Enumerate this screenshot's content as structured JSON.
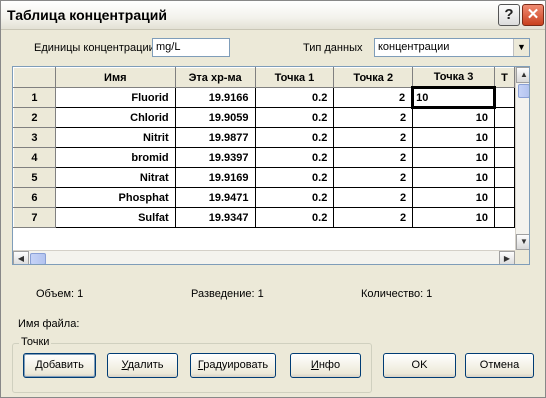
{
  "window": {
    "title": "Таблица концентраций",
    "help_glyph": "?",
    "close_glyph": "✕"
  },
  "units": {
    "label": "Единицы концентрации",
    "value": "mg/L"
  },
  "data_type": {
    "label": "Тип данных",
    "selected": "концентрации"
  },
  "table": {
    "headers": [
      "",
      "Имя",
      "Эта хр-ма",
      "Точка 1",
      "Точка 2",
      "Точка 3",
      "T"
    ],
    "rows": [
      {
        "num": "1",
        "name": "Fluorid",
        "value": "19.9166",
        "p1": "0.2",
        "p2": "2",
        "p3": "10"
      },
      {
        "num": "2",
        "name": "Chlorid",
        "value": "19.9059",
        "p1": "0.2",
        "p2": "2",
        "p3": "10"
      },
      {
        "num": "3",
        "name": "Nitrit",
        "value": "19.9877",
        "p1": "0.2",
        "p2": "2",
        "p3": "10"
      },
      {
        "num": "4",
        "name": "bromid",
        "value": "19.9397",
        "p1": "0.2",
        "p2": "2",
        "p3": "10"
      },
      {
        "num": "5",
        "name": "Nitrat",
        "value": "19.9169",
        "p1": "0.2",
        "p2": "2",
        "p3": "10"
      },
      {
        "num": "6",
        "name": "Phosphat",
        "value": "19.9471",
        "p1": "0.2",
        "p2": "2",
        "p3": "10"
      },
      {
        "num": "7",
        "name": "Sulfat",
        "value": "19.9347",
        "p1": "0.2",
        "p2": "2",
        "p3": "10"
      }
    ]
  },
  "info": {
    "volume": "Объем:  1",
    "dilution": "Разведение:  1",
    "quantity": "Количество:  1",
    "filename_label": "Имя файла:"
  },
  "points_group": {
    "legend": "Точки",
    "add": {
      "hotkey": "Д",
      "rest": "обавить"
    },
    "delete": {
      "hotkey": "У",
      "rest": "далить"
    },
    "calibrate": {
      "hotkey": "Г",
      "rest": "радуировать"
    },
    "info": {
      "hotkey": "И",
      "rest": "нфо"
    }
  },
  "buttons": {
    "ok": "OK",
    "cancel": "Отмена"
  }
}
